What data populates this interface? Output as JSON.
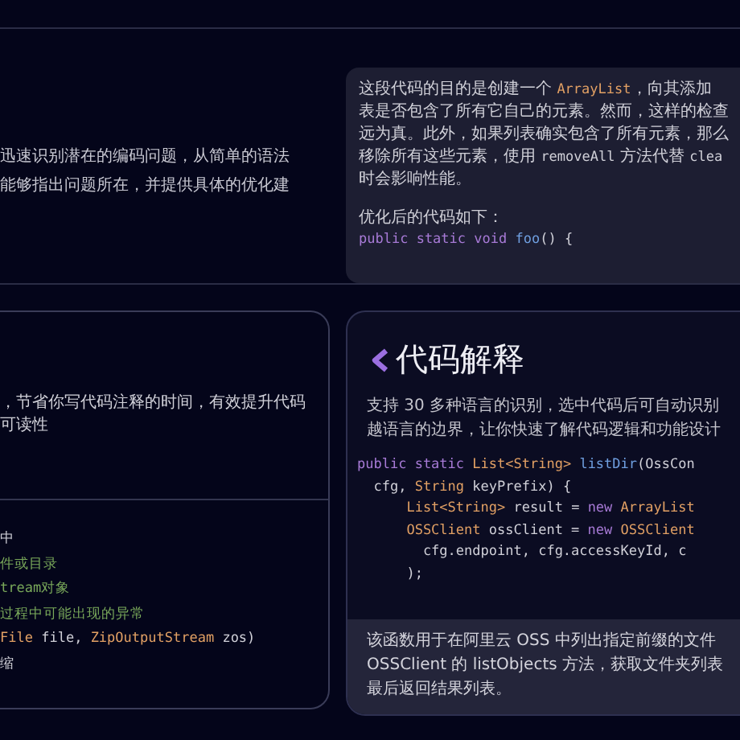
{
  "top_left": {
    "lines": [
      "迅速识别潜在的编码问题，从简单的语法",
      "能够指出问题所在，并提供具体的优化建"
    ]
  },
  "top_card": {
    "lines": [
      [
        {
          "kind": "text",
          "text": "这段代码的目的是创建一个 "
        },
        {
          "kind": "type",
          "text": "ArrayList"
        },
        {
          "kind": "text",
          "text": "，向其添加"
        }
      ],
      [
        {
          "kind": "text",
          "text": "表是否包含了所有它自己的元素。然而，这样的检查"
        }
      ],
      [
        {
          "kind": "text",
          "text": "远为真。此外，如果列表确实包含了所有元素，那么"
        }
      ],
      [
        {
          "kind": "text",
          "text": "移除所有这些元素，使用 "
        },
        {
          "kind": "plain",
          "text": "removeAll"
        },
        {
          "kind": "text",
          "text": " 方法代替 "
        },
        {
          "kind": "plain",
          "text": "clea"
        }
      ],
      [
        {
          "kind": "text",
          "text": "时会影响性能。"
        }
      ]
    ],
    "lead": "优化后的代码如下：",
    "code": [
      [
        {
          "kind": "keyword",
          "text": "public static void "
        },
        {
          "kind": "method",
          "text": "foo"
        },
        {
          "kind": "plain",
          "text": "() {"
        }
      ]
    ]
  },
  "left_card": {
    "description": "，节省你写代码注释的时间，有效提升代码可读性",
    "code": [
      [
        {
          "kind": "plain",
          "text": "中"
        }
      ],
      [
        {
          "kind": "comment",
          "text": "件或目录"
        }
      ],
      [
        {
          "kind": "comment",
          "text": "tream对象"
        }
      ],
      [
        {
          "kind": "comment",
          "text": "过程中可能出现的异常"
        }
      ],
      [
        {
          "kind": "type",
          "text": "File"
        },
        {
          "kind": "plain",
          "text": " file, "
        },
        {
          "kind": "type",
          "text": "ZipOutputStream"
        },
        {
          "kind": "plain",
          "text": " zos)"
        }
      ],
      [
        {
          "kind": "plain",
          "text": "缩"
        }
      ]
    ]
  },
  "right_card": {
    "title": "代码解释",
    "description": [
      "支持 30 多种语言的识别，选中代码后可自动识别",
      "越语言的边界，让你快速了解代码逻辑和功能设计"
    ],
    "code": [
      [
        {
          "kind": "keyword",
          "text": "public static "
        },
        {
          "kind": "type",
          "text": "List<String>"
        },
        {
          "kind": "method",
          "text": " listDir"
        },
        {
          "kind": "plain",
          "text": "(OssCon"
        }
      ],
      [
        {
          "kind": "plain",
          "text": "  cfg, "
        },
        {
          "kind": "type",
          "text": "String"
        },
        {
          "kind": "plain",
          "text": " keyPrefix) {"
        }
      ],
      [
        {
          "kind": "type",
          "text": "      List<String>"
        },
        {
          "kind": "plain",
          "text": " result = "
        },
        {
          "kind": "keyword",
          "text": "new "
        },
        {
          "kind": "type",
          "text": "ArrayList"
        }
      ],
      [
        {
          "kind": "type",
          "text": "      OSSClient"
        },
        {
          "kind": "plain",
          "text": " ossClient = "
        },
        {
          "kind": "keyword",
          "text": "new "
        },
        {
          "kind": "type",
          "text": "OSSClient"
        }
      ],
      [
        {
          "kind": "plain",
          "text": "        cfg.endpoint, cfg.accessKeyId, c"
        }
      ],
      [
        {
          "kind": "plain",
          "text": "      );"
        }
      ]
    ],
    "footer": [
      "该函数用于在阿里云 OSS 中列出指定前缀的文件",
      "OSSClient 的 listObjects 方法，获取文件夹列表",
      "最后返回结果列表。"
    ]
  }
}
